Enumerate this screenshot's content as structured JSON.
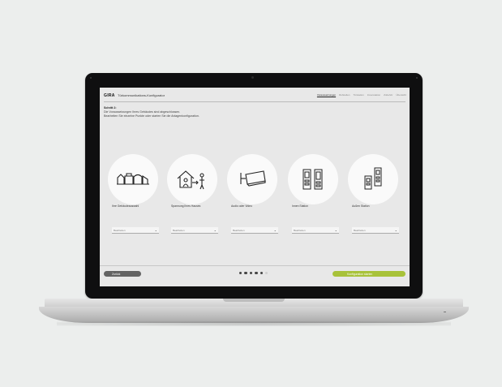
{
  "app": {
    "logo": "GIRA",
    "title": "Türkommunikations-Konfigurator"
  },
  "nav": [
    "Voraussetzungen",
    "Rufstellen",
    "Türstation",
    "Innenstation",
    "Zubehör",
    "Übersicht"
  ],
  "step": {
    "title": "Schritt 2:",
    "line1": "Die Voraussetzungen Ihres Gebäudes sind abgeschlossen.",
    "line2": "Bearbeiten Sie einzelne Punkte oder starten Sie die Anlagenkonfiguration."
  },
  "options": [
    {
      "label": "Ihre Gebäudeauswahl",
      "value": "Bearbeiten"
    },
    {
      "label": "Spannung Ihres Hauses",
      "value": "Bearbeiten"
    },
    {
      "label": "Audio oder Video",
      "value": "Bearbeiten"
    },
    {
      "label": "Innen Station",
      "value": "Bearbeiten"
    },
    {
      "label": "Außen Station",
      "value": "Bearbeiten"
    }
  ],
  "footer": {
    "back_label": "Zurück",
    "next_label": "Konfiguration starten",
    "total_steps": 6,
    "current_step": 5
  },
  "colors": {
    "accent": "#a8c23a",
    "back_button": "#636363"
  }
}
